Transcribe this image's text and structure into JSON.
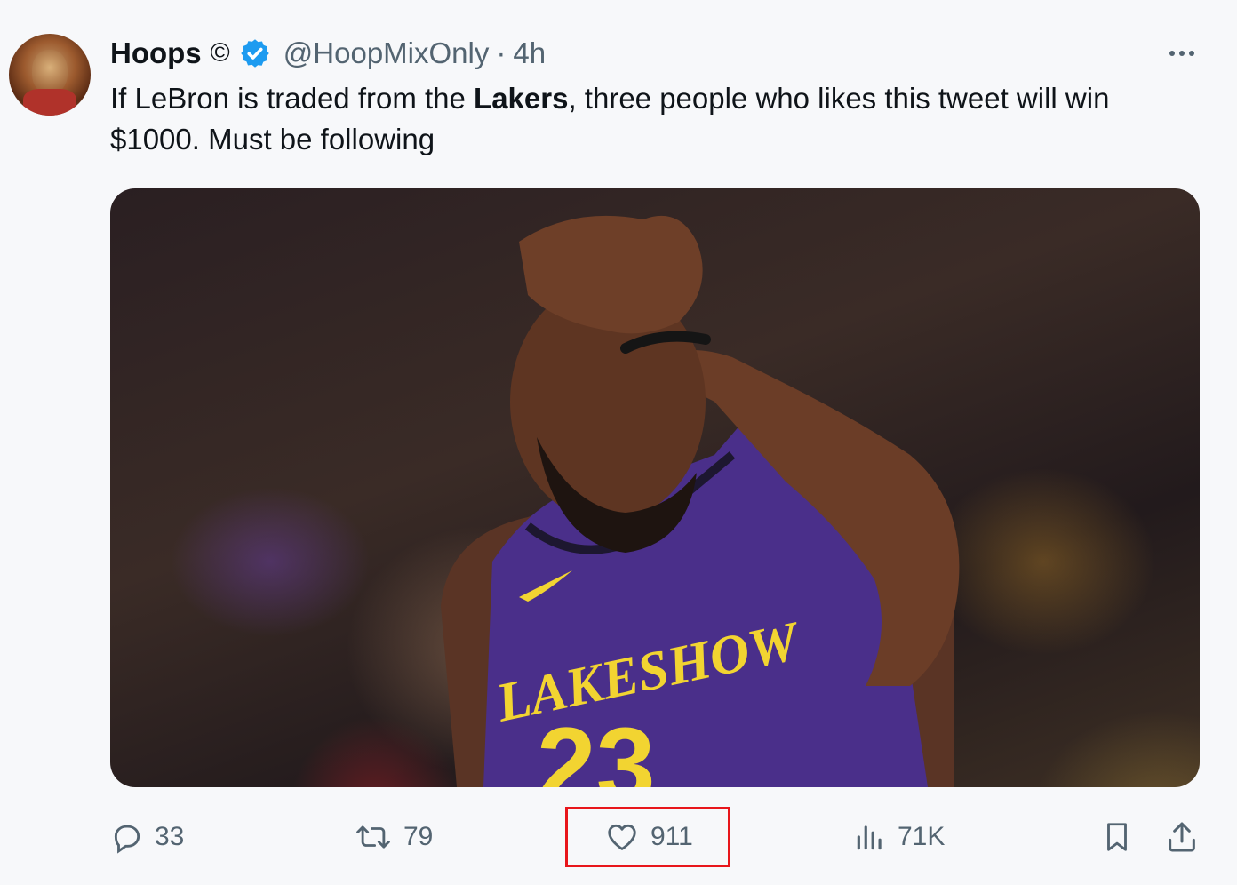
{
  "tweet": {
    "author_name": "Hoops",
    "author_symbol": "©",
    "handle": "@HoopMixOnly",
    "separator": "·",
    "time": "4h",
    "text_part1": "If LeBron is traded from the ",
    "text_bold": "Lakers",
    "text_part2": ", three people who likes this tweet will win $1000. Must be following"
  },
  "media": {
    "jersey_text": "LAKESHOW",
    "jersey_number": "23"
  },
  "actions": {
    "replies": "33",
    "retweets": "79",
    "likes": "911",
    "views": "71K"
  },
  "icons": {
    "verified": "verified-badge-icon",
    "more": "more-dots-icon",
    "reply": "reply-icon",
    "retweet": "retweet-icon",
    "like": "heart-icon",
    "views": "views-icon",
    "bookmark": "bookmark-icon",
    "share": "share-icon"
  },
  "colors": {
    "verified_blue": "#1d9bf0",
    "highlight_red": "#e8161b",
    "secondary_text": "#536471"
  }
}
